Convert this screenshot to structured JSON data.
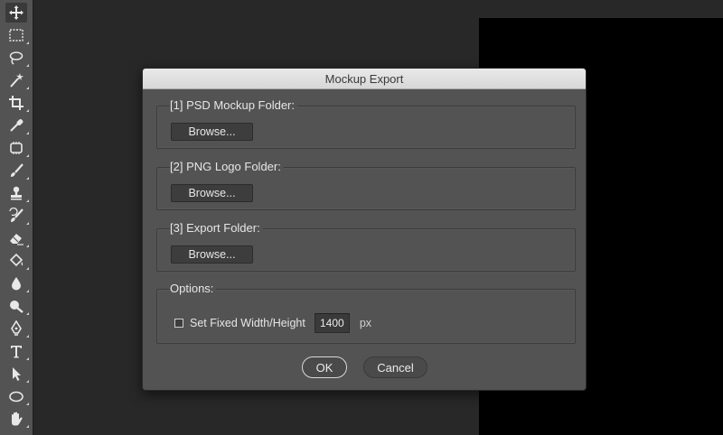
{
  "toolbar": {
    "tools": [
      {
        "icon": "move-tool-icon"
      },
      {
        "icon": "marquee-tool-icon"
      },
      {
        "icon": "lasso-tool-icon"
      },
      {
        "icon": "magic-wand-tool-icon"
      },
      {
        "icon": "crop-tool-icon"
      },
      {
        "icon": "eyedropper-tool-icon"
      },
      {
        "icon": "healing-brush-tool-icon"
      },
      {
        "icon": "brush-tool-icon"
      },
      {
        "icon": "clone-stamp-tool-icon"
      },
      {
        "icon": "history-brush-tool-icon"
      },
      {
        "icon": "eraser-tool-icon"
      },
      {
        "icon": "paint-bucket-tool-icon"
      },
      {
        "icon": "blur-tool-icon"
      },
      {
        "icon": "dodge-tool-icon"
      },
      {
        "icon": "pen-tool-icon"
      },
      {
        "icon": "type-tool-icon"
      },
      {
        "icon": "path-selection-tool-icon"
      },
      {
        "icon": "ellipse-tool-icon"
      },
      {
        "icon": "hand-tool-icon"
      }
    ]
  },
  "dialog": {
    "title": "Mockup Export",
    "groups": [
      {
        "label": "[1] PSD Mockup Folder:",
        "button": "Browse..."
      },
      {
        "label": "[2] PNG Logo Folder:",
        "button": "Browse..."
      },
      {
        "label": "[3] Export Folder:",
        "button": "Browse..."
      }
    ],
    "options": {
      "label": "Options:",
      "checkbox_label": "Set Fixed Width/Height",
      "checked": false,
      "size_value": "1400",
      "unit": "px"
    },
    "ok_label": "OK",
    "cancel_label": "Cancel"
  },
  "colors": {
    "workspace": "#282828",
    "panel": "#535353",
    "canvas": "#000000"
  }
}
